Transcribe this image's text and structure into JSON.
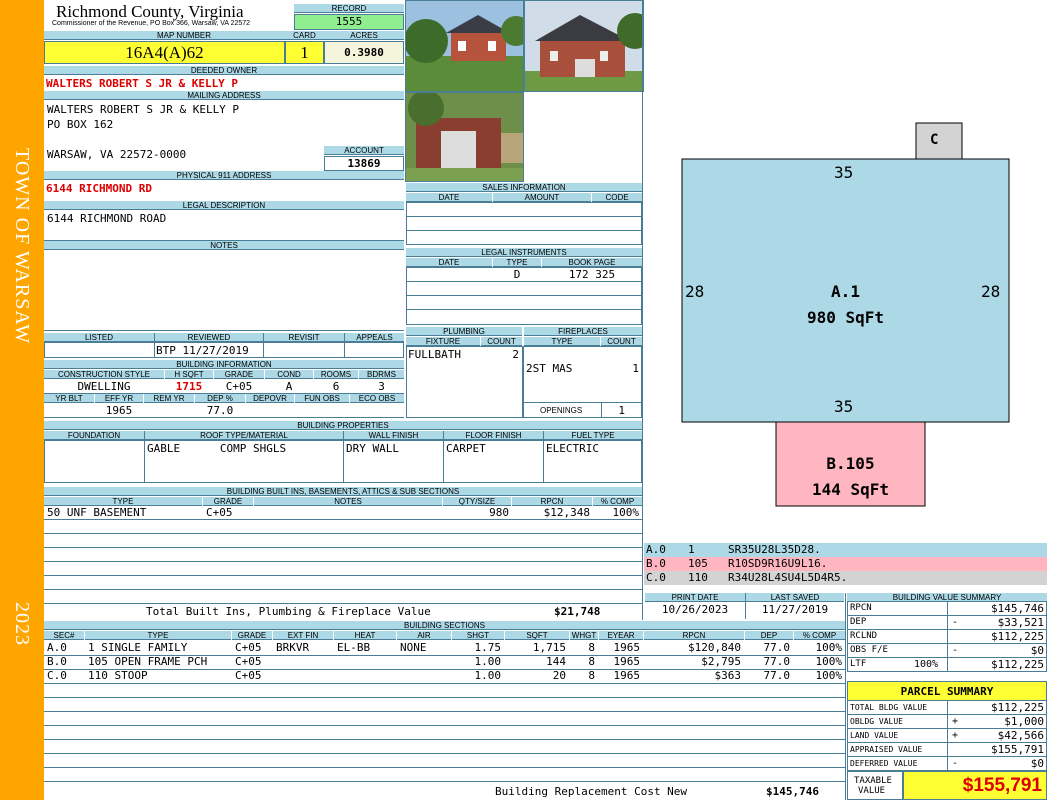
{
  "sidebar": {
    "town": "TOWN OF WARSAW",
    "year": "2023"
  },
  "header": {
    "county": "Richmond County, Virginia",
    "subtitle": "Commissioner of the Revenue, PO Box 366, Warsaw, VA 22572",
    "record_label": "RECORD",
    "record": "1555",
    "map_label": "MAP NUMBER",
    "map_number": "16A4(A)62",
    "card_label": "CARD",
    "card": "1",
    "acres_label": "ACRES",
    "acres": "0.3980"
  },
  "owner": {
    "deeded_label": "DEEDED OWNER",
    "deeded": "WALTERS ROBERT S JR & KELLY P",
    "mailing_label": "MAILING ADDRESS",
    "mail1": "WALTERS ROBERT S JR & KELLY P",
    "mail2": "PO BOX 162",
    "mail3": "WARSAW, VA 22572-0000",
    "account_label": "ACCOUNT",
    "account": "13869",
    "physical_label": "PHYSICAL 911 ADDRESS",
    "physical": "6144 RICHMOND RD",
    "legal_label": "LEGAL DESCRIPTION",
    "legal": "6144 RICHMOND ROAD",
    "notes_label": "NOTES"
  },
  "status": {
    "listed_label": "LISTED",
    "reviewed_label": "REVIEWED",
    "revisit_label": "REVISIT",
    "appeals_label": "APPEALS",
    "reviewed": "BTP 11/27/2019"
  },
  "building_info": {
    "label": "BUILDING INFORMATION",
    "h1": [
      "CONSTRUCTION STYLE",
      "H SQFT",
      "GRADE",
      "COND",
      "ROOMS",
      "BDRMS"
    ],
    "v1": [
      "DWELLING",
      "1715",
      "C+05",
      "A",
      "6",
      "3"
    ],
    "h2": [
      "YR BLT",
      "EFF YR",
      "REM YR",
      "DEP %",
      "DEPOVR",
      "FUN OBS",
      "ECO OBS"
    ],
    "v2": [
      "",
      "1965",
      "",
      "77.0",
      "",
      "",
      ""
    ]
  },
  "properties": {
    "label": "BUILDING PROPERTIES",
    "headers": [
      "FOUNDATION",
      "ROOF TYPE/MATERIAL",
      "WALL FINISH",
      "FLOOR FINISH",
      "FUEL TYPE"
    ],
    "values": [
      "",
      "GABLE      COMP SHGLS",
      "DRY WALL",
      "CARPET",
      "ELECTRIC"
    ]
  },
  "sales": {
    "label": "SALES INFORMATION",
    "headers": [
      "DATE",
      "AMOUNT",
      "CODE"
    ]
  },
  "instruments": {
    "label": "LEGAL INSTRUMENTS",
    "headers": [
      "DATE",
      "TYPE",
      "BOOK PAGE"
    ],
    "row": [
      "",
      "D",
      "172 325"
    ]
  },
  "plumbing": {
    "label": "PLUMBING",
    "headers": [
      "FIXTURE",
      "COUNT"
    ],
    "fixture": "FULLBATH",
    "count": "2"
  },
  "fireplaces": {
    "label": "FIREPLACES",
    "headers": [
      "TYPE",
      "COUNT"
    ],
    "type": "2ST MAS",
    "count": "1",
    "openings_label": "OPENINGS",
    "openings": "1"
  },
  "builtins": {
    "label": "BUILDING BUILT INS, BASEMENTS, ATTICS & SUB SECTIONS",
    "headers": [
      "TYPE",
      "GRADE",
      "NOTES",
      "QTY/SIZE",
      "RPCN",
      "% COMP"
    ],
    "row": [
      "50 UNF BASEMENT",
      "C+05",
      "",
      "980",
      "$12,348",
      "100%"
    ],
    "total_label": "Total Built Ins, Plumbing & Fireplace Value",
    "total": "$21,748"
  },
  "sketch": {
    "c_label": "C",
    "top": "35",
    "bottom": "35",
    "left": "28",
    "right": "28",
    "a_label": "A.1",
    "a_area": "980 SqFt",
    "b_label": "B.105",
    "b_area": "144 SqFt",
    "colors": {
      "a": "#add8e6",
      "b": "#ffb6c1",
      "c": "#d3d3d3"
    }
  },
  "legend": [
    {
      "code": "A.0",
      "num": "1",
      "desc": "SR35U28L35D28.",
      "color": "#add8e6"
    },
    {
      "code": "B.0",
      "num": "105",
      "desc": "R10SD9R16U9L16.",
      "color": "#ffb6c1"
    },
    {
      "code": "C.0",
      "num": "110",
      "desc": "R34U28L4SU4L5D4R5.",
      "color": "#d3d3d3"
    }
  ],
  "dates": {
    "print_label": "PRINT DATE",
    "print": "10/26/2023",
    "saved_label": "LAST SAVED",
    "saved": "11/27/2019"
  },
  "sections": {
    "label": "BUILDING SECTIONS",
    "headers": [
      "SEC#",
      "TYPE",
      "GRADE",
      "EXT FIN",
      "HEAT",
      "AIR",
      "SHGT",
      "SQFT",
      "WHGT",
      "EYEAR",
      "RPCN",
      "DEP",
      "% COMP"
    ],
    "rows": [
      [
        "A.0",
        "1 SINGLE FAMILY",
        "C+05",
        "BRKVR",
        "EL-BB",
        "NONE",
        "1.75",
        "1,715",
        "8",
        "1965",
        "$120,840",
        "77.0",
        "100%"
      ],
      [
        "B.0",
        "105 OPEN FRAME PCH",
        "C+05",
        "",
        "",
        "",
        "1.00",
        "144",
        "8",
        "1965",
        "$2,795",
        "77.0",
        "100%"
      ],
      [
        "C.0",
        "110 STOOP",
        "C+05",
        "",
        "",
        "",
        "1.00",
        "20",
        "8",
        "1965",
        "$363",
        "77.0",
        "100%"
      ]
    ],
    "total_label": "Building Replacement Cost New",
    "total": "$145,746"
  },
  "value_summary": {
    "label": "BUILDING VALUE SUMMARY",
    "rows": [
      {
        "k": "RPCN",
        "s": "",
        "v": "$145,746"
      },
      {
        "k": "DEP",
        "s": "-",
        "v": "$33,521"
      },
      {
        "k": "RCLND",
        "s": "",
        "v": "$112,225"
      },
      {
        "k": "OBS F/E",
        "s": "-",
        "v": "$0"
      },
      {
        "k": "LTF",
        "p": "100%",
        "s": "",
        "v": "$112,225"
      }
    ]
  },
  "parcel": {
    "label": "PARCEL SUMMARY",
    "rows": [
      {
        "k": "TOTAL BLDG VALUE",
        "s": "",
        "v": "$112,225"
      },
      {
        "k": "OBLDG VALUE",
        "s": "+",
        "v": "$1,000"
      },
      {
        "k": "LAND VALUE",
        "s": "+",
        "v": "$42,566"
      },
      {
        "k": "APPRAISED VALUE",
        "s": "",
        "v": "$155,791"
      },
      {
        "k": "DEFERRED VALUE",
        "s": "-",
        "v": "$0"
      }
    ],
    "taxable_label1": "TAXABLE",
    "taxable_label2": "VALUE",
    "taxable": "$155,791"
  }
}
